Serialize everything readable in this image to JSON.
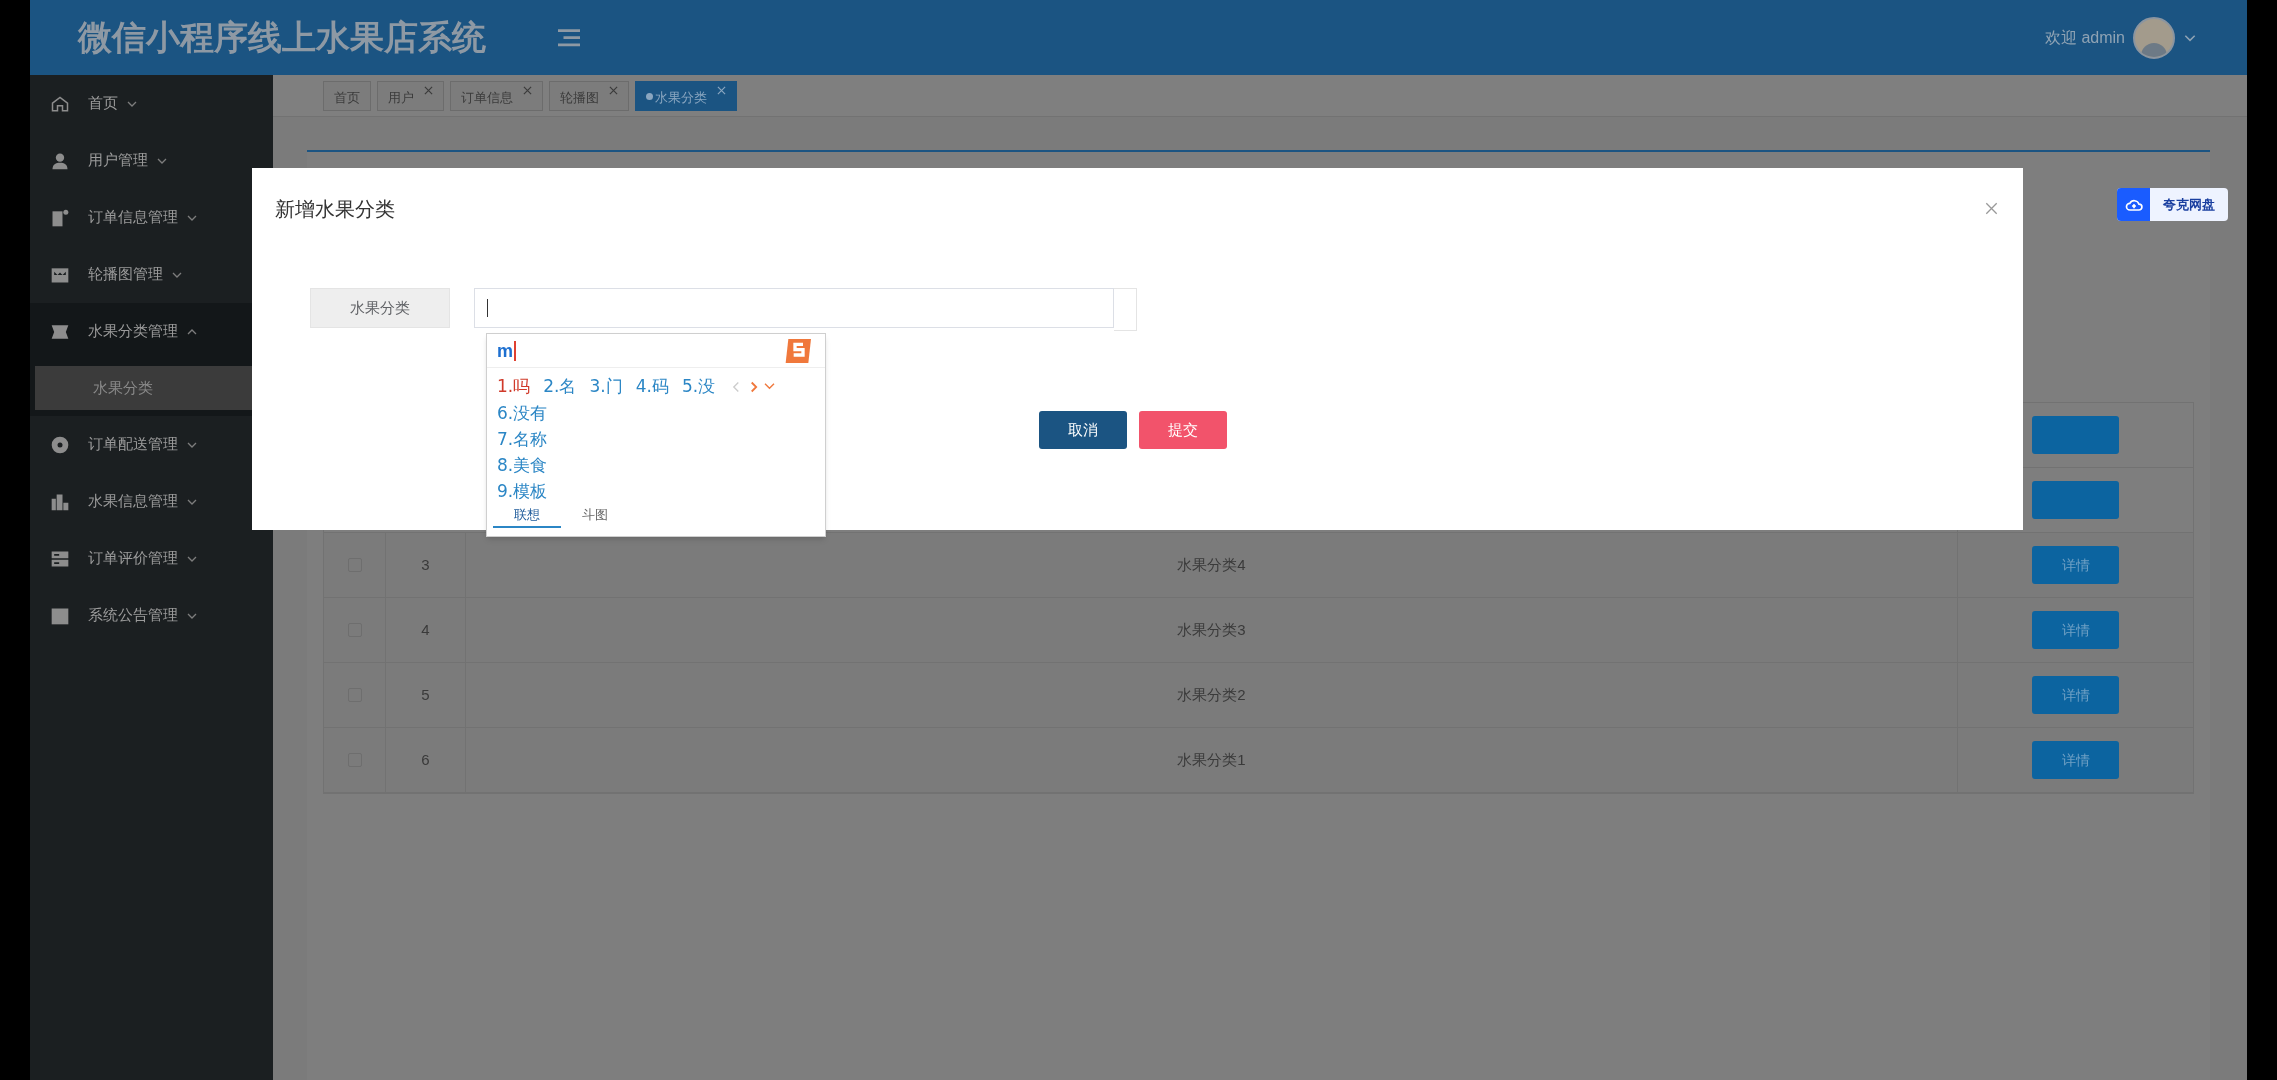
{
  "header": {
    "title": "微信小程序线上水果店系统",
    "welcome": "欢迎 admin"
  },
  "sidebar": {
    "items": [
      {
        "label": "首页",
        "expanded": false
      },
      {
        "label": "用户管理",
        "expanded": false
      },
      {
        "label": "订单信息管理",
        "expanded": false
      },
      {
        "label": "轮播图管理",
        "expanded": false
      },
      {
        "label": "水果分类管理",
        "expanded": true,
        "children": [
          {
            "label": "水果分类",
            "selected": true
          }
        ]
      },
      {
        "label": "订单配送管理",
        "expanded": false
      },
      {
        "label": "水果信息管理",
        "expanded": false
      },
      {
        "label": "订单评价管理",
        "expanded": false
      },
      {
        "label": "系统公告管理",
        "expanded": false
      }
    ]
  },
  "tabs": [
    {
      "label": "首页",
      "closable": false,
      "selected": false
    },
    {
      "label": "用户",
      "closable": true,
      "selected": false
    },
    {
      "label": "订单信息",
      "closable": true,
      "selected": false
    },
    {
      "label": "轮播图",
      "closable": true,
      "selected": false
    },
    {
      "label": "水果分类",
      "closable": true,
      "selected": true
    }
  ],
  "table": {
    "rows": [
      {
        "checked": false,
        "index": "3",
        "name": "水果分类4",
        "action": "详情"
      },
      {
        "checked": false,
        "index": "4",
        "name": "水果分类3",
        "action": "详情"
      },
      {
        "checked": false,
        "index": "5",
        "name": "水果分类2",
        "action": "详情"
      },
      {
        "checked": false,
        "index": "6",
        "name": "水果分类1",
        "action": "详情"
      }
    ]
  },
  "dialog": {
    "title": "新增水果分类",
    "field_label": "水果分类",
    "buttons": [
      {
        "label": "取消",
        "kind": "cancel"
      },
      {
        "label": "提交",
        "kind": "submit"
      }
    ]
  },
  "ime": {
    "input": "m",
    "candidates": [
      {
        "label": "1.吗",
        "selected": true
      },
      {
        "label": "2.名",
        "selected": false
      },
      {
        "label": "3.门",
        "selected": false
      },
      {
        "label": "4.码",
        "selected": false
      },
      {
        "label": "5.没",
        "selected": false
      },
      {
        "label": "6.没有",
        "selected": false
      },
      {
        "label": "7.名称",
        "selected": false
      },
      {
        "label": "8.美食",
        "selected": false
      },
      {
        "label": "9.模板",
        "selected": false
      }
    ],
    "tabs": [
      {
        "label": "联想",
        "selected": true
      },
      {
        "label": "斗图",
        "selected": false
      }
    ]
  },
  "badge": {
    "label": "夸克网盘"
  }
}
